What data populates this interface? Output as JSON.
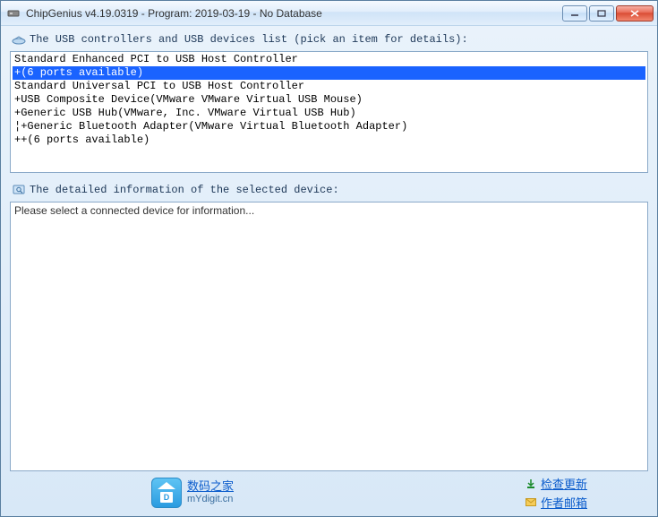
{
  "window": {
    "title": "ChipGenius v4.19.0319 - Program: 2019-03-19 - No Database"
  },
  "list_header": "The USB controllers and USB devices list (pick an item for details):",
  "devices": [
    {
      "label": "Standard Enhanced PCI to USB Host Controller",
      "selected": false
    },
    {
      "label": "+(6 ports available)",
      "selected": true
    },
    {
      "label": "Standard Universal PCI to USB Host Controller",
      "selected": false
    },
    {
      "label": "+USB Composite Device(VMware VMware Virtual USB Mouse)",
      "selected": false
    },
    {
      "label": "+Generic USB Hub(VMware, Inc. VMware Virtual USB Hub)",
      "selected": false
    },
    {
      "label": "¦+Generic Bluetooth Adapter(VMware Virtual Bluetooth Adapter)",
      "selected": false
    },
    {
      "label": "++(6 ports available)",
      "selected": false
    }
  ],
  "detail_header": "The detailed information of the selected device:",
  "detail_body": "Please select a connected device for information...",
  "footer": {
    "site_cn": "数码之家",
    "site_url": "mYdigit.cn",
    "check_update": "检查更新",
    "author_mail": "作者邮箱"
  }
}
